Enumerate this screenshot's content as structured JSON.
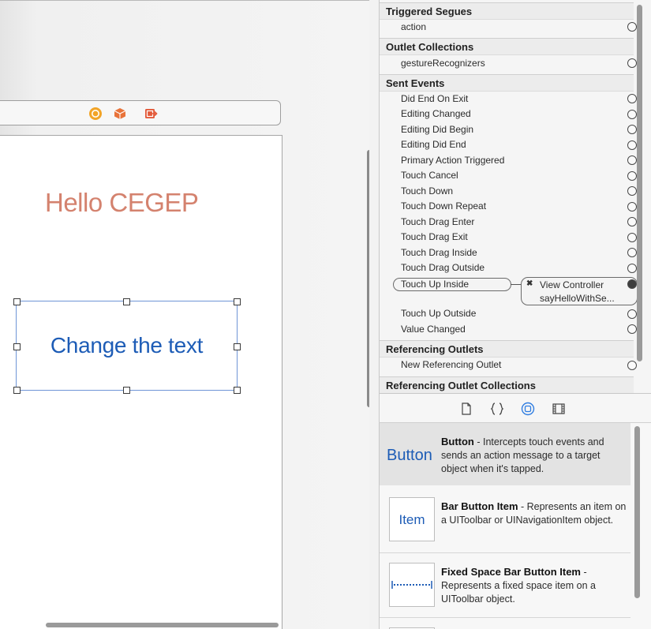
{
  "canvas": {
    "dock_icons": [
      "view-controller-icon",
      "first-responder-icon",
      "exit-icon"
    ],
    "hello_label": "Hello CEGEP",
    "button_title": "Change the text",
    "colors": {
      "label_text": "#d4826e",
      "button_text": "#1d5cb6",
      "selection": "#6f95d6"
    }
  },
  "inspector": {
    "sections": [
      {
        "title": "Triggered Segues",
        "rows": [
          "action"
        ]
      },
      {
        "title": "Outlet Collections",
        "rows": [
          "gestureRecognizers"
        ]
      },
      {
        "title": "Sent Events",
        "rows": [
          "Did End On Exit",
          "Editing Changed",
          "Editing Did Begin",
          "Editing Did End",
          "Primary Action Triggered",
          "Touch Cancel",
          "Touch Down",
          "Touch Down Repeat",
          "Touch Drag Enter",
          "Touch Drag Exit",
          "Touch Drag Inside",
          "Touch Drag Outside",
          "Touch Up Inside",
          "Touch Up Outside",
          "Value Changed"
        ]
      },
      {
        "title": "Referencing Outlets",
        "rows": [
          "New Referencing Outlet"
        ]
      },
      {
        "title": "Referencing Outlet Collections",
        "rows": []
      }
    ],
    "connection": {
      "event": "Touch Up Inside",
      "remove_symbol": "✖",
      "target": "View Controller",
      "method": "sayHelloWithSe..."
    }
  },
  "library_tabs": [
    "file-template-icon",
    "code-snippet-icon",
    "object-library-icon",
    "media-library-icon"
  ],
  "library": {
    "items": [
      {
        "thumb": "Button",
        "name": "Button",
        "description": " - Intercepts touch events and sends an action message to a target object when it's tapped."
      },
      {
        "thumb": "Item",
        "name": "Bar Button Item",
        "description": " - Represents an item on a UIToolbar or UINavigationItem object."
      },
      {
        "thumb": "",
        "name": "Fixed Space Bar Button Item",
        "description": " - Represents a fixed space item on a UIToolbar object."
      }
    ]
  }
}
